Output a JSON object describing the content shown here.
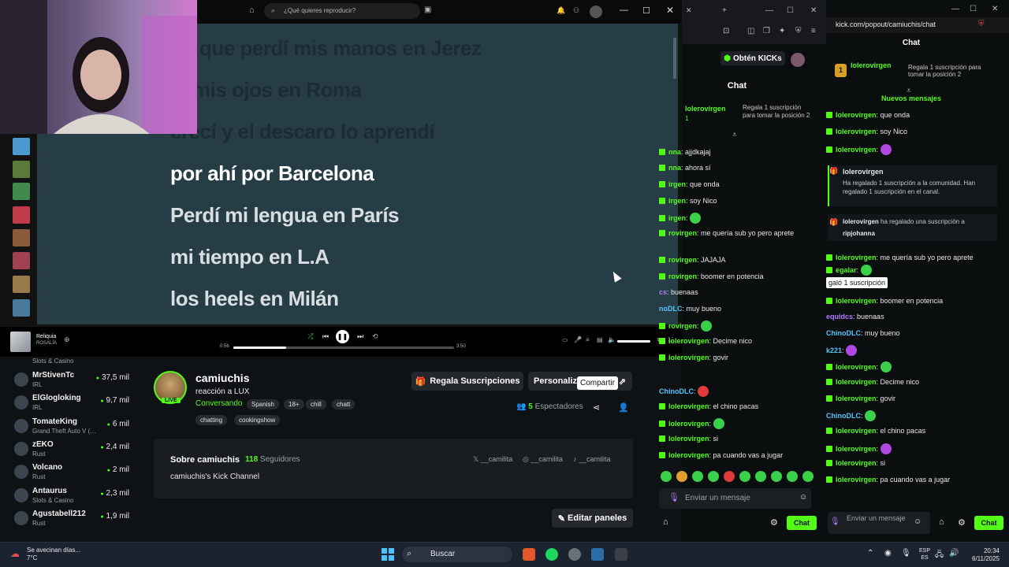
{
  "spotify": {
    "search_placeholder": "¿Qué quieres reproducir?",
    "lyrics": [
      "que perdí mis manos en Jerez",
      "mis ojos en Roma",
      "crecí y el descaro lo aprendí",
      "por ahí por Barcelona",
      "Perdí mi lengua en París",
      "mi tiempo en L.A",
      "los heels en Milán"
    ],
    "now_playing": {
      "title": "Reliquia",
      "artist": "ROSALÍA",
      "elapsed": "0:56",
      "total": "3:50",
      "progress": 0.24
    }
  },
  "stream": {
    "streamer": "camiuchis",
    "title": "reacción a LUX",
    "category": "Conversando",
    "live": "LIVE",
    "tags": [
      "Spanish",
      "18+",
      "chill",
      "chatt",
      "chatting",
      "cookingshow"
    ],
    "gift_subs": "Regala Suscripciones",
    "personalize": "Personaliz",
    "tooltip": "Compartir",
    "viewers_count": "5",
    "viewers_label": "Espectadores",
    "about_title": "Sobre camiuchis",
    "followers_count": "118",
    "followers_label": "Seguidores",
    "about_desc": "camiuchis's Kick Channel",
    "socials": [
      "__camilita",
      "__camilita",
      "__camilita"
    ],
    "edit_panels": "Editar paneles"
  },
  "recommended": [
    {
      "name": "",
      "category": "Slots & Casino",
      "viewers": ""
    },
    {
      "name": "MrStivenTc",
      "category": "IRL",
      "viewers": "37,5 mil"
    },
    {
      "name": "ElGlogloking",
      "category": "IRL",
      "viewers": "9,7 mil"
    },
    {
      "name": "TomateKing",
      "category": "Grand Theft Auto V (…",
      "viewers": "6 mil"
    },
    {
      "name": "zEKO",
      "category": "Rust",
      "viewers": "2,4 mil"
    },
    {
      "name": "Volcano",
      "category": "Rust",
      "viewers": "2 mil"
    },
    {
      "name": "Antaurus",
      "category": "Slots & Casino",
      "viewers": "2,3 mil"
    },
    {
      "name": "Agustabell212",
      "category": "Rust",
      "viewers": "1,9 mil"
    }
  ],
  "mid_chat": {
    "kicks": "Obtén KICKs",
    "title": "Chat",
    "pinned_user": "lolerovirgen",
    "pinned_count": "1",
    "pinned_text": "Regala 1 suscripción para tomar la posición 2",
    "messages": [
      {
        "user": "nna",
        "text": "ajjdkajaj",
        "style": "u"
      },
      {
        "user": "nna",
        "text": "ahora sí",
        "style": "u"
      },
      {
        "user": "irgen",
        "text": "que onda",
        "style": "u"
      },
      {
        "user": "irgen",
        "text": "soy Nico",
        "style": "u"
      },
      {
        "user": "irgen",
        "text": "",
        "style": "u"
      },
      {
        "user": "rovirgen",
        "text": "me quería sub yo pero aprete",
        "style": "u"
      },
      {
        "user": "rovirgen",
        "text": "JAJAJA",
        "style": "u"
      },
      {
        "user": "rovirgen",
        "text": "boomer en potencia",
        "style": "u"
      },
      {
        "user": "cs",
        "text": "buenaas",
        "style": "u3"
      },
      {
        "user": "noDLC",
        "text": "muy bueno",
        "style": "u2"
      },
      {
        "user": "rovirgen",
        "text": "",
        "style": "u"
      },
      {
        "user": "lolerovirgen",
        "text": "Decime nico",
        "style": "u"
      },
      {
        "user": "lolerovirgen",
        "text": "govir",
        "style": "u"
      },
      {
        "user": "ChinoDLC",
        "text": "",
        "style": "u2"
      },
      {
        "user": "lolerovirgen",
        "text": "el chino pacas",
        "style": "u"
      },
      {
        "user": "lolerovirgen",
        "text": "",
        "style": "u"
      },
      {
        "user": "lolerovirgen",
        "text": "si",
        "style": "u"
      },
      {
        "user": "lolerovirgen",
        "text": "pa cuando vas a jugar",
        "style": "u"
      }
    ],
    "input_placeholder": "Enviar un mensaje",
    "send": "Chat"
  },
  "pop_chat": {
    "url": "kick.com/popout/camiuchis/chat",
    "title": "Chat",
    "pinned_user": "lolerovirgen",
    "pinned_count": "1",
    "pinned_text": "Regala 1 suscripción para tomar la posición 2",
    "new_messages": "Nuevos mensajes",
    "gift_user": "lolerovirgen",
    "gift_line1": "Ha regalado 1 suscripción a la comunidad. Han regalado 1 suscripción en el canal.",
    "gift2_user": "lolerovirgen",
    "gift2_text": "ha regalado una suscripción a",
    "gift2_target": "ripjohanna",
    "tooltip": "galó 1 suscripción",
    "messages": [
      {
        "user": "lolerovirgen",
        "text": "que onda",
        "style": "u"
      },
      {
        "user": "lolerovirgen",
        "text": "soy Nico",
        "style": "u"
      },
      {
        "user": "lolerovirgen",
        "text": "",
        "style": "u"
      },
      {
        "user": "lolerovirgen",
        "text": "me quería sub yo pero aprete",
        "style": "u"
      },
      {
        "user": "egalar",
        "text": "",
        "style": "u"
      },
      {
        "user": "lolerovirgen",
        "text": "boomer en potencia",
        "style": "u"
      },
      {
        "user": "equidcs",
        "text": "buenaas",
        "style": "u3"
      },
      {
        "user": "ChinoDLC",
        "text": "muy bueno",
        "style": "u2"
      },
      {
        "user": "k221",
        "text": "",
        "style": "u2"
      },
      {
        "user": "lolerovirgen",
        "text": "",
        "style": "u"
      },
      {
        "user": "lolerovirgen",
        "text": "Decime nico",
        "style": "u"
      },
      {
        "user": "lolerovirgen",
        "text": "govir",
        "style": "u"
      },
      {
        "user": "ChinoDLC",
        "text": "",
        "style": "u2"
      },
      {
        "user": "lolerovirgen",
        "text": "el chino pacas",
        "style": "u"
      },
      {
        "user": "lolerovirgen",
        "text": "",
        "style": "u"
      },
      {
        "user": "lolerovirgen",
        "text": "si",
        "style": "u"
      },
      {
        "user": "lolerovirgen",
        "text": "pa cuando vas a jugar",
        "style": "u"
      }
    ],
    "input_placeholder": "Enviar un mensaje",
    "send": "Chat"
  },
  "taskbar": {
    "weather_line1": "Se avecinan días...",
    "weather_line2": "7°C",
    "search": "Buscar",
    "lang1": "ESP",
    "lang2": "ES",
    "time": "20:34",
    "date": "6/11/2025"
  },
  "colors": {
    "kick_green": "#53fc18",
    "lyrics_bg": "#273d46",
    "taskbar": "#1c2330"
  }
}
